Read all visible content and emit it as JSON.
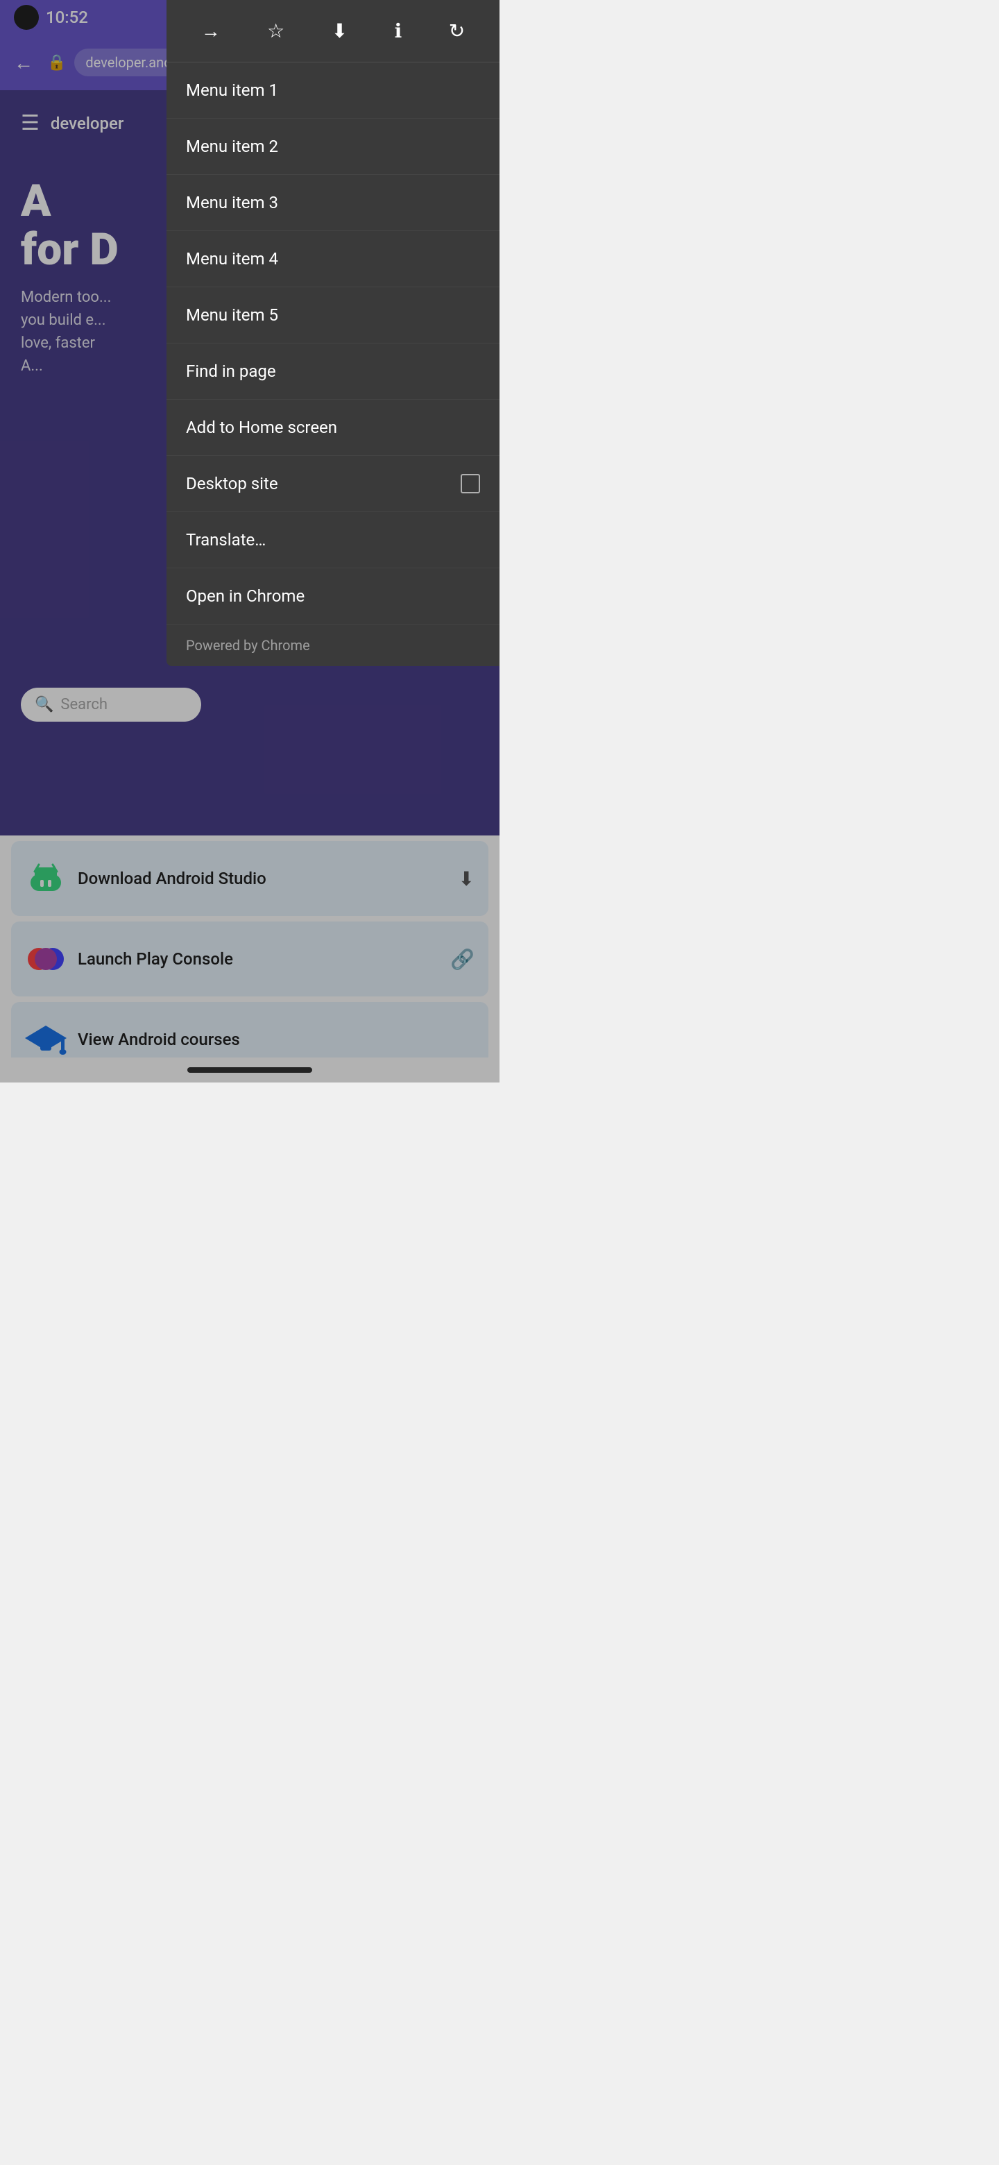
{
  "statusBar": {
    "time": "10:52",
    "icons": [
      "wifi",
      "signal",
      "battery"
    ]
  },
  "browserBar": {
    "url": "developer.and",
    "backLabel": "←",
    "lockLabel": "🔒"
  },
  "page": {
    "logoText": "developer",
    "heroTitle": "A",
    "heroSubtitle": "Modern too...\nyou build e...\nlove, faster\nA...",
    "searchPlaceholder": "Search"
  },
  "cards": [
    {
      "label": "Download Android Studio",
      "iconType": "android",
      "actionIcon": "download"
    },
    {
      "label": "Launch Play Console",
      "iconType": "play",
      "actionIcon": "external"
    },
    {
      "label": "View Android courses",
      "iconType": "graduation",
      "actionIcon": ""
    }
  ],
  "menu": {
    "toolbar": {
      "forwardLabel": "→",
      "bookmarkLabel": "☆",
      "downloadLabel": "⬇",
      "infoLabel": "ℹ",
      "refreshLabel": "↻"
    },
    "items": [
      {
        "id": "menu-item-1",
        "label": "Menu item 1",
        "hasCheckbox": false
      },
      {
        "id": "menu-item-2",
        "label": "Menu item 2",
        "hasCheckbox": false
      },
      {
        "id": "menu-item-3",
        "label": "Menu item 3",
        "hasCheckbox": false
      },
      {
        "id": "menu-item-4",
        "label": "Menu item 4",
        "hasCheckbox": false
      },
      {
        "id": "menu-item-5",
        "label": "Menu item 5",
        "hasCheckbox": false
      },
      {
        "id": "find-in-page",
        "label": "Find in page",
        "hasCheckbox": false
      },
      {
        "id": "add-to-home-screen",
        "label": "Add to Home screen",
        "hasCheckbox": false
      },
      {
        "id": "desktop-site",
        "label": "Desktop site",
        "hasCheckbox": true
      },
      {
        "id": "translate",
        "label": "Translate…",
        "hasCheckbox": false
      },
      {
        "id": "open-in-chrome",
        "label": "Open in Chrome",
        "hasCheckbox": false
      }
    ],
    "footer": "Powered by Chrome"
  }
}
